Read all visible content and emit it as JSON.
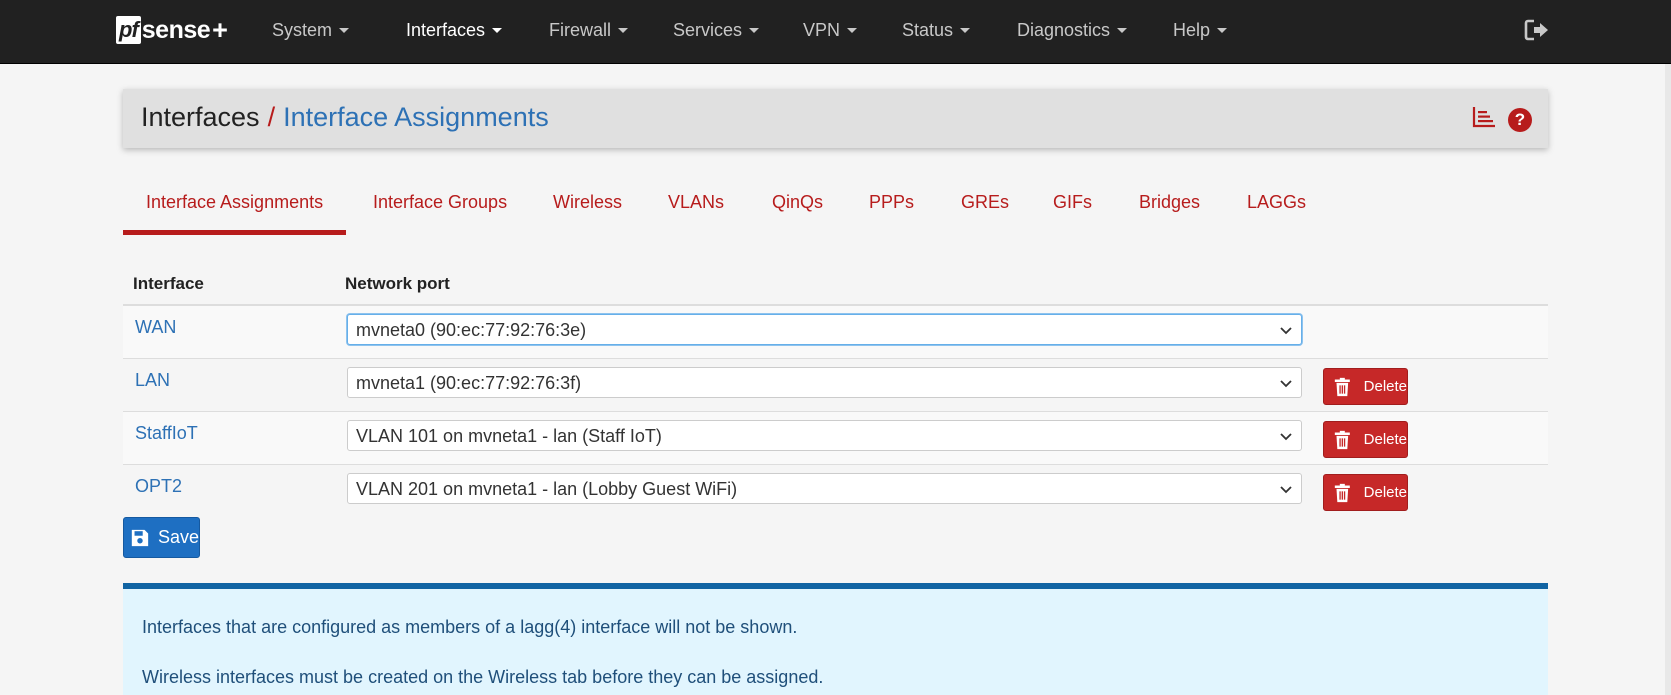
{
  "brand": {
    "logo_pf": "pf",
    "logo_sense": "sense",
    "logo_plus": "+"
  },
  "nav": {
    "items": [
      {
        "label": "System"
      },
      {
        "label": "Interfaces"
      },
      {
        "label": "Firewall"
      },
      {
        "label": "Services"
      },
      {
        "label": "VPN"
      },
      {
        "label": "Status"
      },
      {
        "label": "Diagnostics"
      },
      {
        "label": "Help"
      }
    ],
    "active": "Interfaces"
  },
  "breadcrumb": {
    "parent": "Interfaces",
    "separator": "/",
    "current": "Interface Assignments",
    "help_label": "?"
  },
  "tabs": [
    {
      "label": "Interface Assignments"
    },
    {
      "label": "Interface Groups"
    },
    {
      "label": "Wireless"
    },
    {
      "label": "VLANs"
    },
    {
      "label": "QinQs"
    },
    {
      "label": "PPPs"
    },
    {
      "label": "GREs"
    },
    {
      "label": "GIFs"
    },
    {
      "label": "Bridges"
    },
    {
      "label": "LAGGs"
    }
  ],
  "table": {
    "headers": {
      "interface": "Interface",
      "port": "Network port"
    },
    "rows": [
      {
        "interface": "WAN",
        "port": "mvneta0 (90:ec:77:92:76:3e)",
        "delete": ""
      },
      {
        "interface": "LAN",
        "port": "mvneta1 (90:ec:77:92:76:3f)",
        "delete": "Delete"
      },
      {
        "interface": "StaffIoT",
        "port": "VLAN 101 on mvneta1 - lan (Staff IoT)",
        "delete": "Delete"
      },
      {
        "interface": "OPT2",
        "port": "VLAN 201 on mvneta1 - lan (Lobby Guest WiFi)",
        "delete": "Delete"
      }
    ]
  },
  "save_label": "Save",
  "info": {
    "line1": "Interfaces that are configured as members of a lagg(4) interface will not be shown.",
    "line2": "Wireless interfaces must be created on the Wireless tab before they can be assigned."
  },
  "colors": {
    "accent_red": "#b71c1c",
    "link_blue": "#2d71b5",
    "navbar": "#212121",
    "info_bg": "#e1f5fe"
  }
}
